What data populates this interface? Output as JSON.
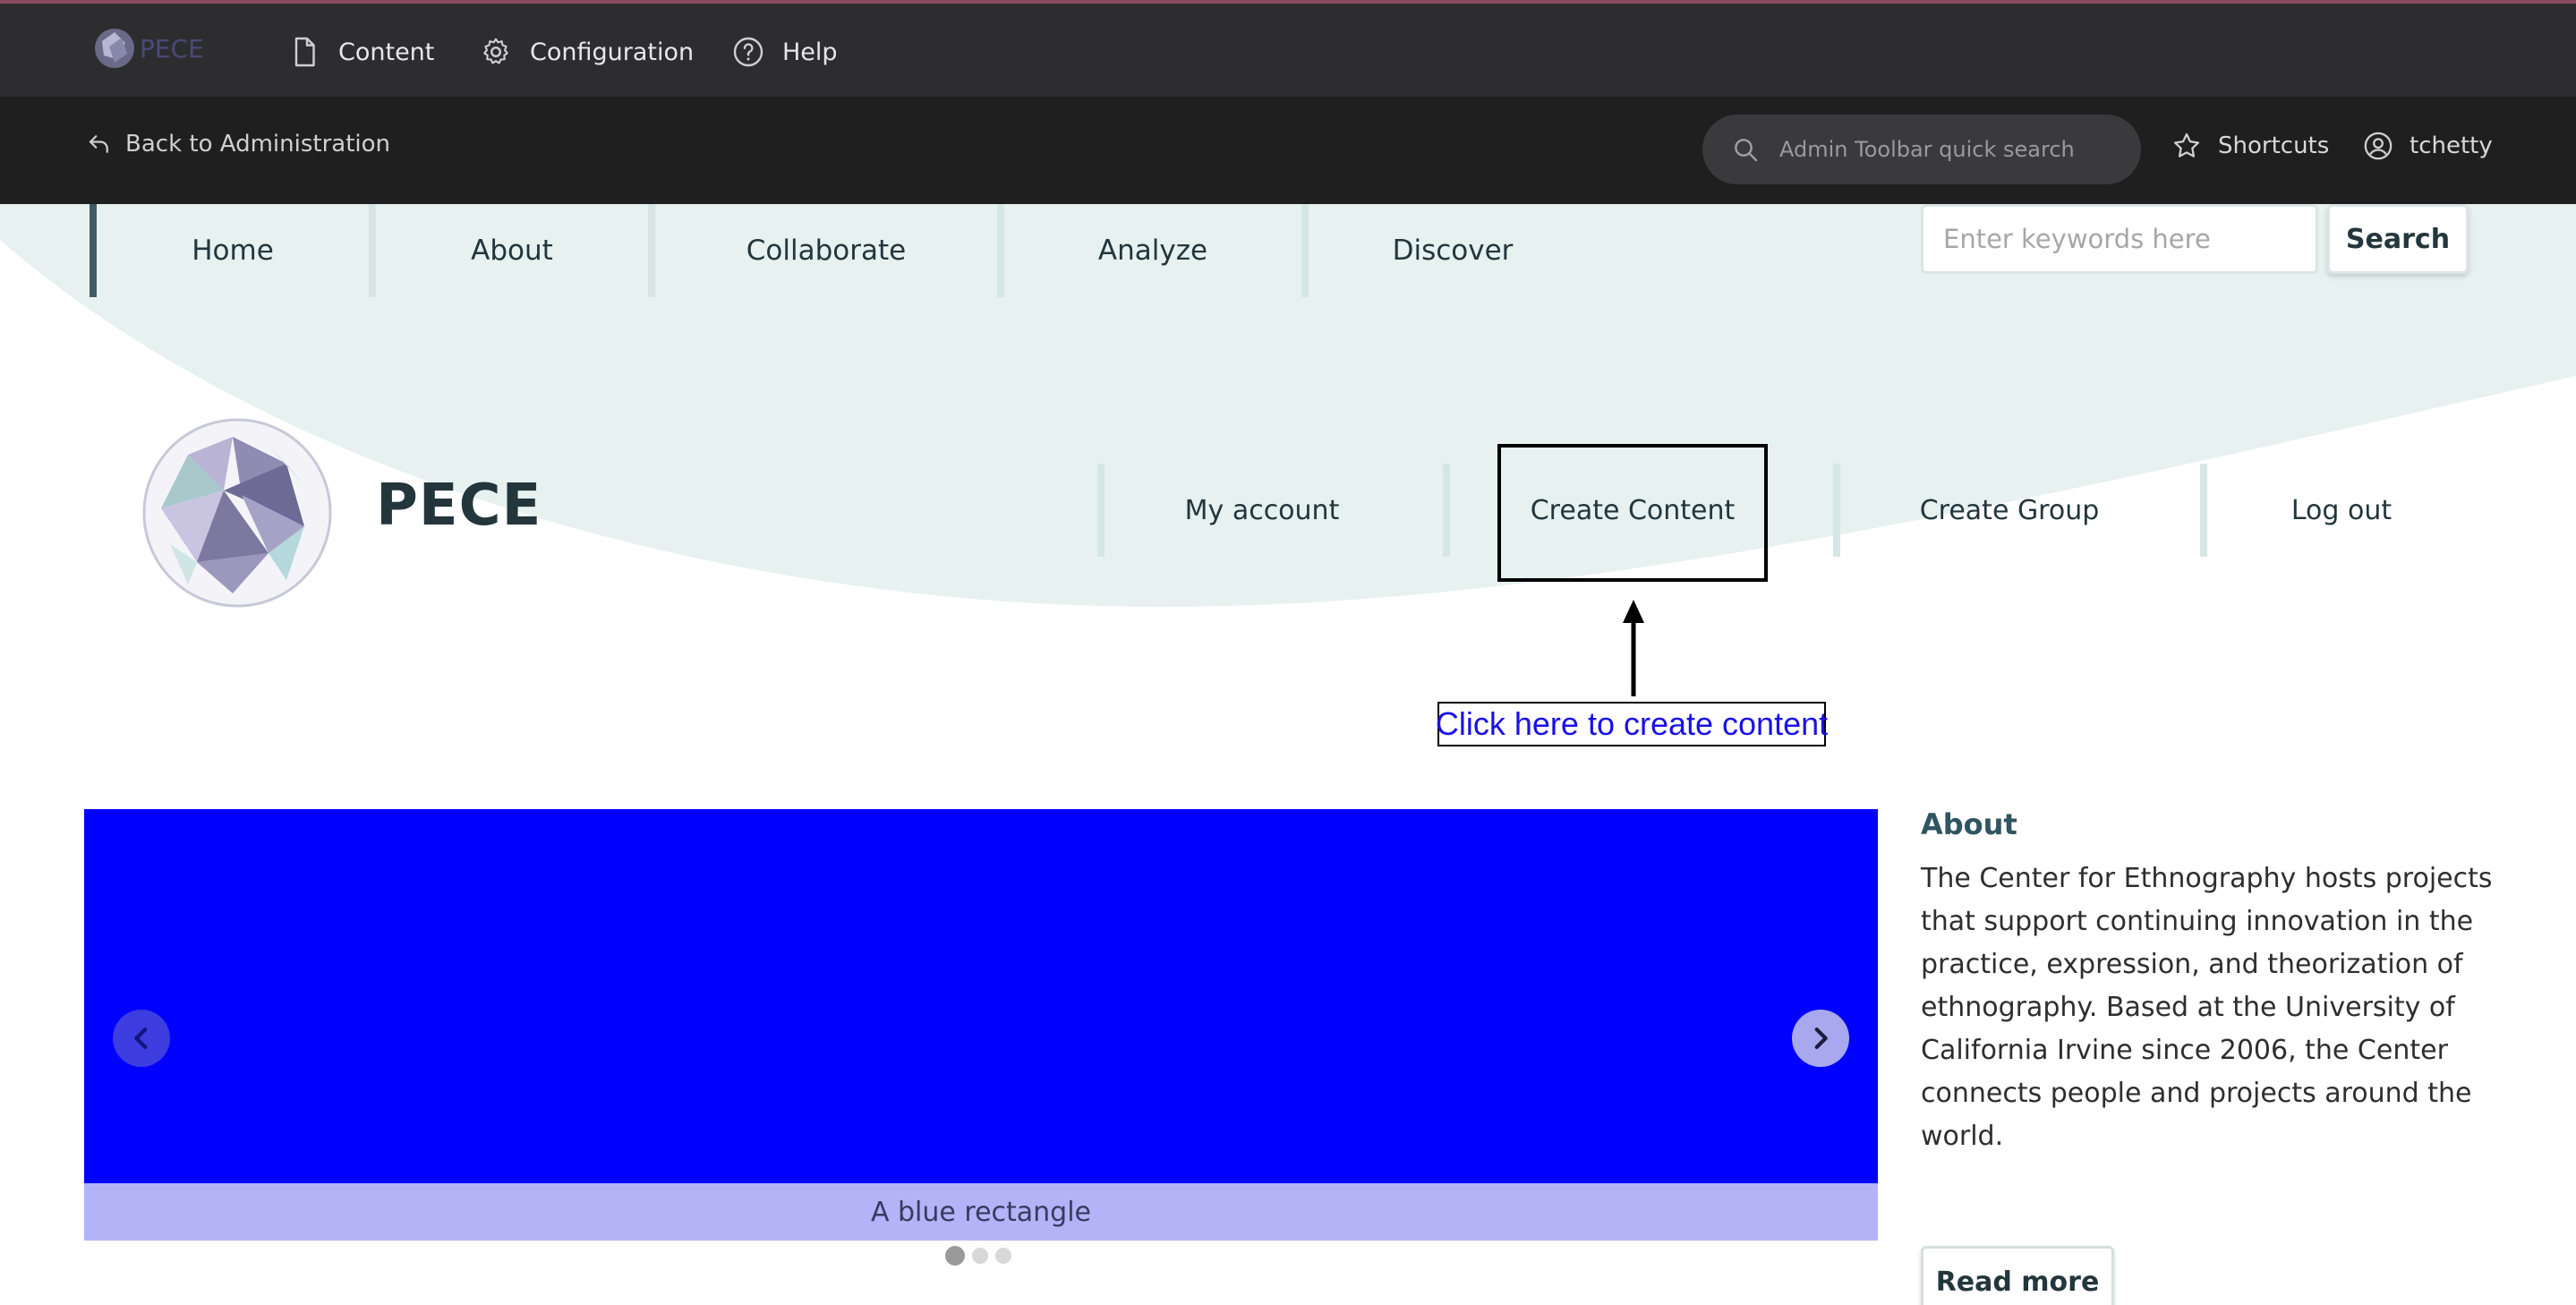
{
  "admin_toolbar": {
    "logo_text": "PECE",
    "content_label": "Content",
    "configuration_label": "Configuration",
    "help_label": "Help",
    "back_label": "Back to Administration",
    "quick_search_placeholder": "Admin Toolbar quick search",
    "shortcuts_label": "Shortcuts",
    "user_label": "tchetty"
  },
  "main_nav": {
    "items": [
      {
        "label": "Home"
      },
      {
        "label": "About"
      },
      {
        "label": "Collaborate"
      },
      {
        "label": "Analyze"
      },
      {
        "label": "Discover"
      }
    ]
  },
  "site_search": {
    "placeholder": "Enter keywords here",
    "button_label": "Search"
  },
  "branding": {
    "site_name": "PECE"
  },
  "secondary_nav": {
    "items": [
      {
        "label": "My account"
      },
      {
        "label": "Create Content"
      },
      {
        "label": "Create Group"
      },
      {
        "label": "Log out"
      }
    ]
  },
  "annotation": {
    "callout_text": "Click here to create content"
  },
  "slider": {
    "caption": "A blue rectangle",
    "slide_color": "#0000ff",
    "slide_count": 3,
    "active_slide": 1
  },
  "about": {
    "title": "About",
    "text": "The Center for Ethnography hosts projects that support continuing innovation in the practice, expression, and theorization of ethnography. Based at the University of California Irvine since 2006, the Center connects people and projects around the world.",
    "read_more_label": "Read more"
  },
  "colors": {
    "admin_bar": "#2d2d30",
    "admin_subbar": "#1f1f20",
    "wave": "#e6f1f0",
    "brand_text": "#23363c",
    "callout_text": "#1a10e8"
  }
}
